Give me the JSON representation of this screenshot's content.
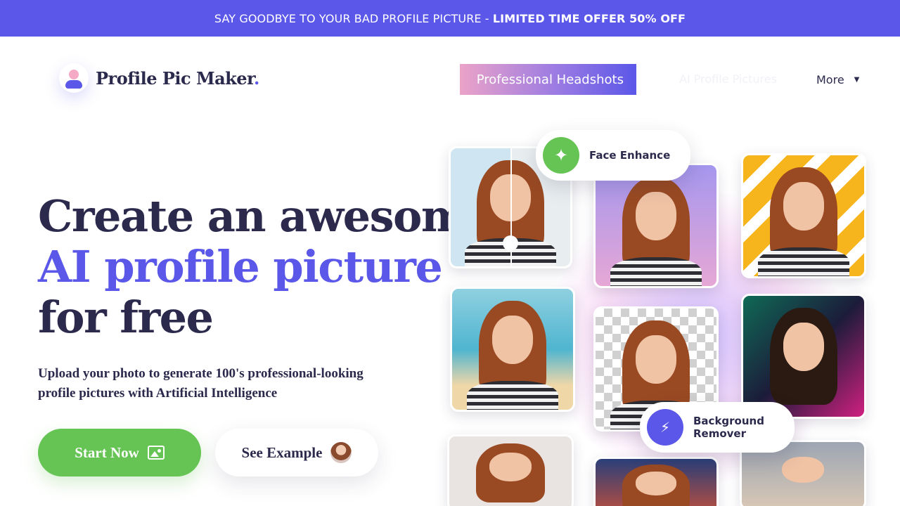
{
  "banner": {
    "icon_left": "",
    "text": "SAY GOODBYE TO YOUR BAD PROFILE PICTURE -",
    "offer": "LIMITED TIME OFFER 50% OFF",
    "icon_right": ""
  },
  "logo": {
    "name": "Profile Pic Maker",
    "dot": "."
  },
  "nav": {
    "headshots_icon": "",
    "headshots_label": "Professional Headshots",
    "ghost_link": "AI Profile Pictures",
    "more_label": "More",
    "more_caret": "▼"
  },
  "hero": {
    "title_line1": "Create an awesome",
    "title_line2": "AI profile picture",
    "title_line3": "for free",
    "subtitle": "Upload your photo to generate 100's professional-looking profile pictures with Artificial Intelligence",
    "start_label": "Start Now",
    "example_label": "See Example"
  },
  "collage": {
    "face_enhance_label": "Face Enhance",
    "face_enhance_icon": "✦",
    "bg_remover_label_1": "Background",
    "bg_remover_label_2": "Remover",
    "bg_remover_icon": "⚡"
  },
  "colors": {
    "brand": "#5b57e8",
    "green": "#66c454",
    "text": "#2b2a4c"
  }
}
